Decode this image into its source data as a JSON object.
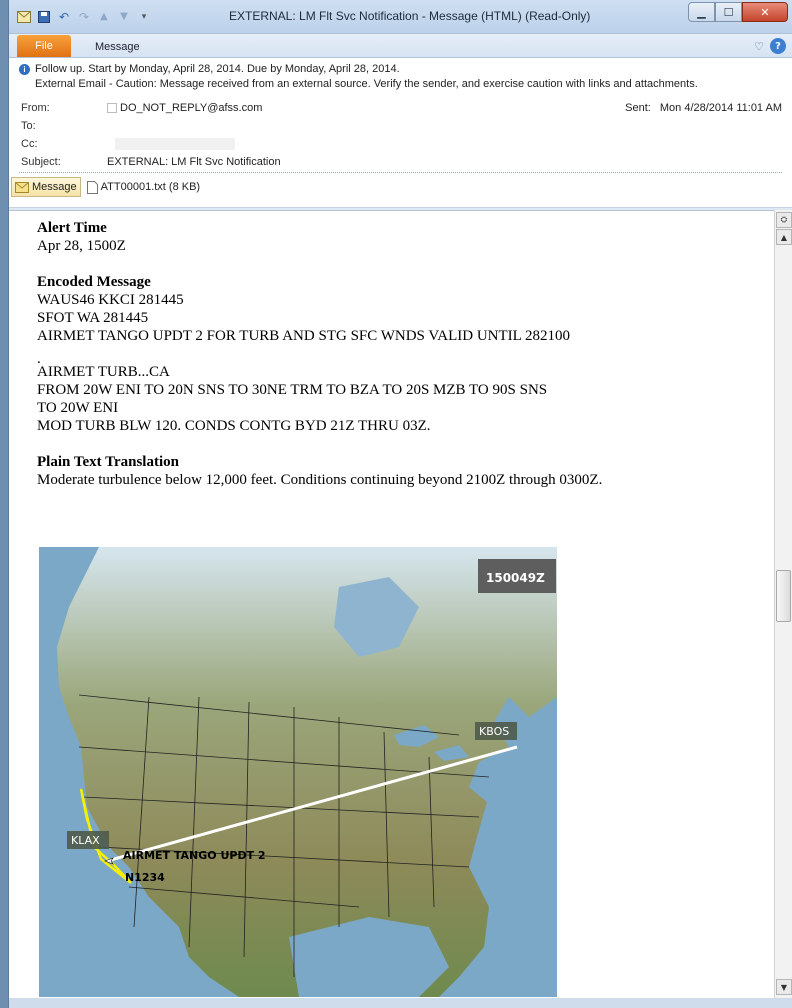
{
  "window": {
    "title": "EXTERNAL: LM Flt Svc Notification  -  Message (HTML) (Read-Only)"
  },
  "ribbon": {
    "file_tab": "File",
    "message_tab": "Message"
  },
  "header": {
    "follow_up": "Follow up.  Start by Monday, April 28, 2014.  Due by Monday, April 28, 2014.",
    "external_warning": "External Email - Caution: Message received from an external source. Verify the sender, and exercise caution with links and attachments.",
    "from_label": "From:",
    "from_value": "DO_NOT_REPLY@afss.com",
    "to_label": "To:",
    "cc_label": "Cc:",
    "subject_label": "Subject:",
    "subject_value": "EXTERNAL: LM Flt Svc Notification",
    "sent_label": "Sent:",
    "sent_value": "Mon 4/28/2014 11:01 AM"
  },
  "attachments": {
    "message_button": "Message",
    "file": "ATT00001.txt (8 KB)"
  },
  "body": {
    "alert_time_heading": "Alert Time",
    "alert_time_value": "Apr 28, 1500Z",
    "encoded_heading": "Encoded Message",
    "encoded_lines": [
      "WAUS46 KKCI 281445",
      "SFOT WA 281445",
      "AIRMET TANGO UPDT 2 FOR TURB AND STG SFC WNDS VALID UNTIL 282100",
      ".",
      "AIRMET TURB...CA",
      "FROM 20W ENI TO 20N SNS TO 30NE TRM TO BZA TO 20S MZB TO 90S SNS",
      "TO 20W ENI",
      "MOD TURB BLW 120. CONDS CONTG BYD 21Z THRU 03Z."
    ],
    "plain_heading": "Plain Text Translation",
    "plain_text": "Moderate turbulence below 12,000 feet. Conditions continuing beyond 2100Z through 0300Z."
  },
  "map": {
    "time_label": "150049Z",
    "origin": "KLAX",
    "destination": "KBOS",
    "airmet_label": "AIRMET TANGO UPDT 2",
    "aircraft": "N1234"
  },
  "colors": {
    "file_tab": "#e27214",
    "route": "#ffffff",
    "airmet": "#f5f000"
  }
}
